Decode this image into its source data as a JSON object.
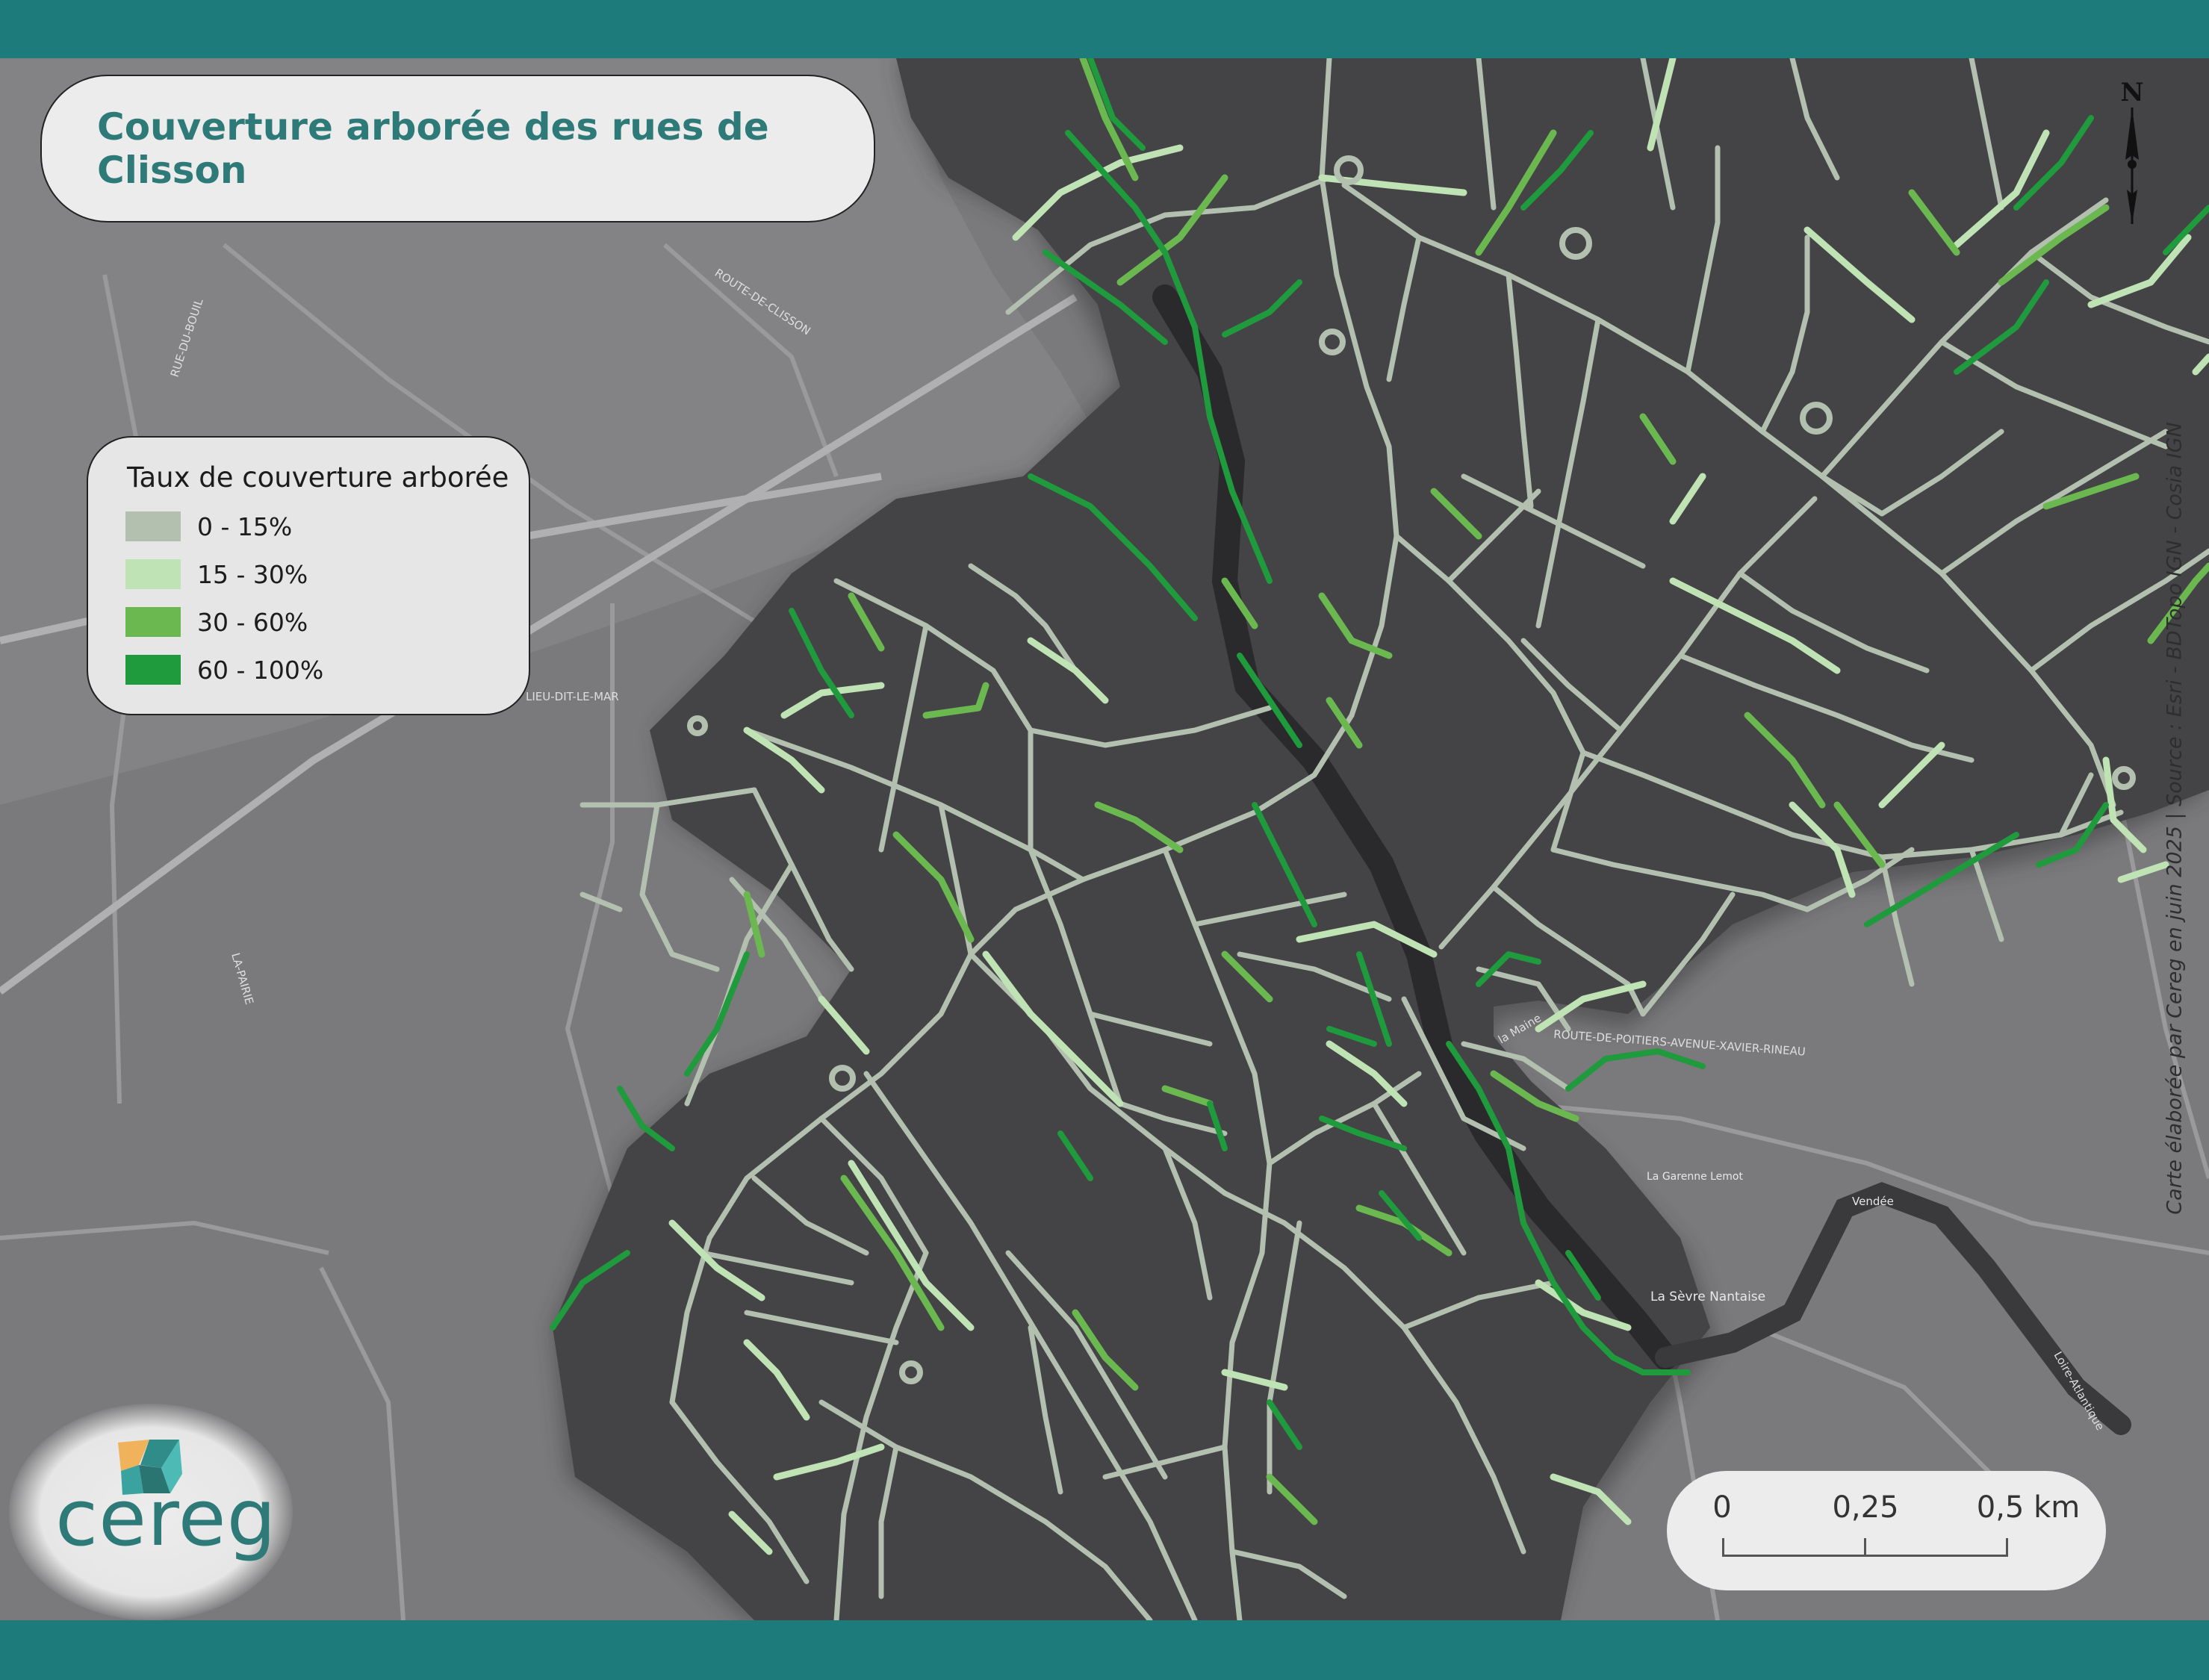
{
  "title": "Couverture arborée des rues de Clisson",
  "legend": {
    "title": "Taux de couverture arborée",
    "classes": [
      {
        "label": "0 - 15%",
        "color": "#b3c0b0"
      },
      {
        "label": "15 - 30%",
        "color": "#bfe3b4"
      },
      {
        "label": "30 - 60%",
        "color": "#6ab84f"
      },
      {
        "label": "60 - 100%",
        "color": "#1f9a3c"
      }
    ]
  },
  "scale_bar": {
    "labels": [
      "0",
      "0,25",
      "0,5 km"
    ]
  },
  "north_arrow": {
    "label": "N",
    "icon": "north-arrow-icon"
  },
  "logo": {
    "text": "cereg",
    "icon": "cereg-logo-icon"
  },
  "credit": "Carte élaborée par Cereg en juin 2025 | Source : Esri - BDTopo IGN - Cosia IGN",
  "basemap_labels": {
    "route_de_clisson": "ROUTE-DE-CLISSON",
    "route_poitiers": "ROUTE-DE-POITIERS-AVENUE-XAVIER-RINEAU",
    "la_sevre_nantaise": "La Sèvre Nantaise",
    "la_garenne_lemot": "La Garenne Lemot",
    "vendee": "Vendée",
    "loire_atlantique": "Loire-Atlantique",
    "la_maine": "la Maine",
    "la_pairie": "LA-PAIRIE",
    "lieu_dit_le_mar": "LIEU-DIT-LE-MAR",
    "rue_du_bouil": "RUE-DU-BOUIL"
  },
  "colors": {
    "band": "#1e7b7c",
    "title_text": "#2e7a79",
    "basemap": "#7a7a7c",
    "study_area": "#444446",
    "river": "#2b2b2d"
  }
}
